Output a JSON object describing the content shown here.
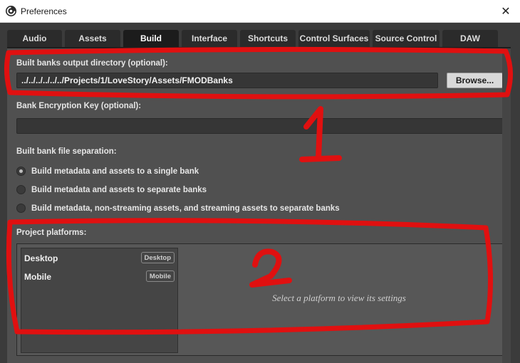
{
  "window": {
    "title": "Preferences",
    "close_glyph": "✕"
  },
  "tabs": [
    {
      "label": "Audio",
      "active": false
    },
    {
      "label": "Assets",
      "active": false
    },
    {
      "label": "Build",
      "active": true
    },
    {
      "label": "Interface",
      "active": false
    },
    {
      "label": "Shortcuts",
      "active": false
    },
    {
      "label": "Control Surfaces",
      "active": false
    },
    {
      "label": "Source Control",
      "active": false
    },
    {
      "label": "DAW",
      "active": false
    }
  ],
  "build": {
    "output_dir_label": "Built banks output directory (optional):",
    "output_dir_value": "../../../../../../Projects/1/LoveStory/Assets/FMODBanks",
    "browse_label": "Browse...",
    "encryption_label": "Bank Encryption Key (optional):",
    "encryption_value": "",
    "separation_label": "Built bank file separation:",
    "separation_options": [
      {
        "label": "Build metadata and assets to a single bank",
        "checked": true
      },
      {
        "label": "Build metadata and assets to separate banks",
        "checked": false
      },
      {
        "label": "Build metadata, non-streaming assets, and streaming assets to separate banks",
        "checked": false
      }
    ],
    "platforms_label": "Project platforms:",
    "platforms": [
      {
        "name": "Desktop",
        "badge": "Desktop"
      },
      {
        "name": "Mobile",
        "badge": "Mobile"
      }
    ],
    "platform_hint": "Select a platform to view its settings"
  },
  "annotations": {
    "color": "#e01010",
    "labels": [
      "1",
      "2"
    ]
  },
  "colors": {
    "panel_bg": "#505050",
    "active_tab": "#1c1c1c",
    "tab_bg": "#2b2b2b"
  },
  "icons": [
    "fmod-logo-icon",
    "close-icon"
  ]
}
